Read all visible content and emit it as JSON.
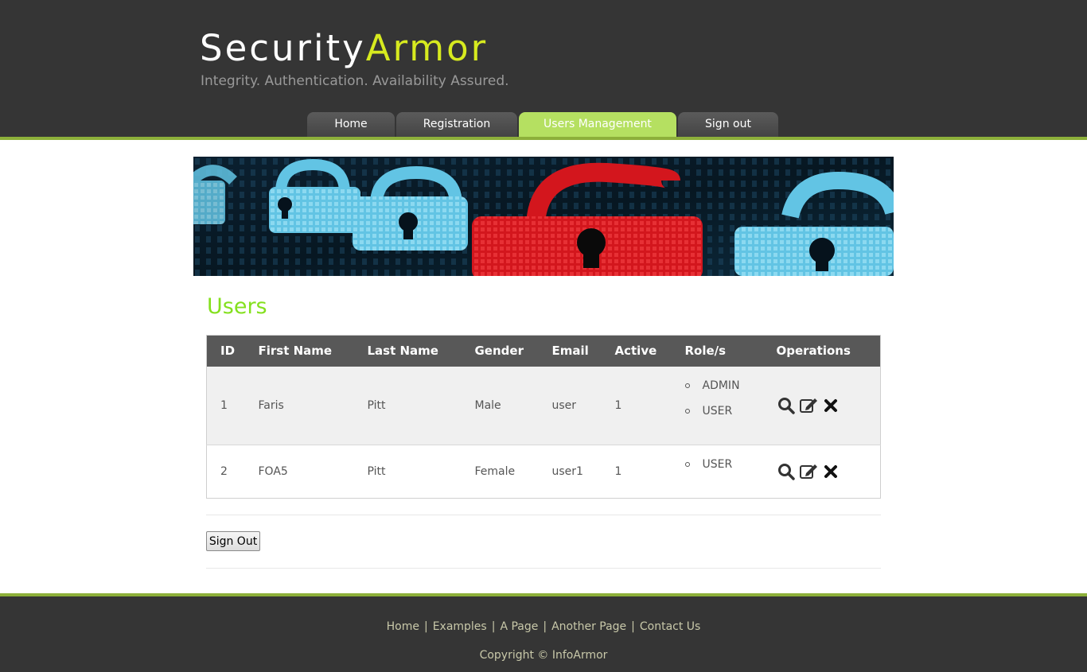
{
  "header": {
    "logo_part1": "Security",
    "logo_part2": "Armor",
    "slogan": "Integrity. Authentication. Availability Assured.",
    "accent_color": "#d7ea1f"
  },
  "nav": {
    "items": [
      {
        "label": "Home",
        "active": false
      },
      {
        "label": "Registration",
        "active": false
      },
      {
        "label": "Users Management",
        "active": true
      },
      {
        "label": "Sign out",
        "active": false
      }
    ],
    "active_color": "#b5e061"
  },
  "banner": {
    "description_icons": [
      "lock-icon",
      "lock-icon",
      "lock-icon",
      "lock-icon"
    ]
  },
  "main": {
    "title": "Users",
    "title_color": "#84e01e",
    "table": {
      "headers": [
        "ID",
        "First Name",
        "Last Name",
        "Gender",
        "Email",
        "Active",
        "Role/s",
        "Operations"
      ],
      "rows": [
        {
          "id": "1",
          "first_name": "Faris",
          "last_name": "Pitt",
          "gender": "Male",
          "email": "user",
          "active": "1",
          "roles": [
            "ADMIN",
            "USER"
          ]
        },
        {
          "id": "2",
          "first_name": "FOA5",
          "last_name": "Pitt",
          "gender": "Female",
          "email": "user1",
          "active": "1",
          "roles": [
            "USER"
          ]
        }
      ],
      "operation_icons": [
        "search-icon",
        "edit-icon",
        "delete-icon"
      ]
    },
    "signout_button": "Sign Out"
  },
  "footer": {
    "links": [
      "Home",
      "Examples",
      "A Page",
      "Another Page",
      "Contact Us"
    ],
    "separator": "|",
    "copyright": "Copyright © InfoArmor"
  }
}
